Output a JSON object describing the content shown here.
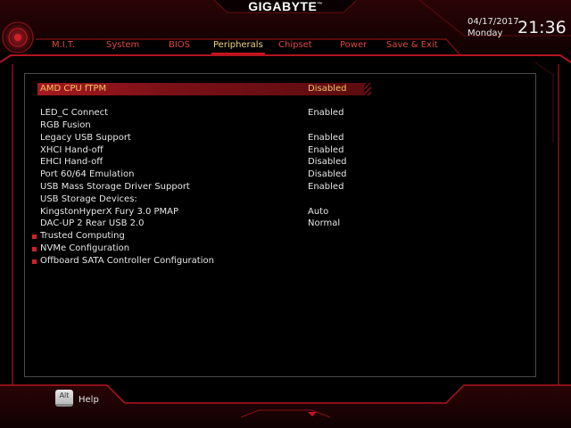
{
  "brand": "GIGABYTE",
  "brand_mark": "™",
  "clock": {
    "date": "04/17/2017",
    "day": "Monday",
    "time": "21:36"
  },
  "tabs": [
    {
      "label": "M.I.T."
    },
    {
      "label": "System"
    },
    {
      "label": "BIOS"
    },
    {
      "label": "Peripherals",
      "active": true
    },
    {
      "label": "Chipset"
    },
    {
      "label": "Power"
    },
    {
      "label": "Save & Exit"
    }
  ],
  "settings": [
    {
      "label": "AMD CPU fTPM",
      "value": "Disabled",
      "selected": true
    },
    {
      "label": "LED_C Connect",
      "value": "Enabled"
    },
    {
      "label": "RGB Fusion",
      "value": ""
    },
    {
      "label": "Legacy USB Support",
      "value": "Enabled"
    },
    {
      "label": "XHCI Hand-off",
      "value": "Enabled"
    },
    {
      "label": "EHCI Hand-off",
      "value": "Disabled"
    },
    {
      "label": "Port 60/64 Emulation",
      "value": "Disabled"
    },
    {
      "label": "USB Mass Storage Driver Support",
      "value": "Enabled"
    },
    {
      "label": "USB Storage Devices:",
      "value": ""
    },
    {
      "label": "KingstonHyperX Fury 3.0 PMAP",
      "value": "Auto"
    },
    {
      "label": "DAC-UP 2 Rear USB 2.0",
      "value": "Normal"
    },
    {
      "label": "Trusted Computing",
      "value": "",
      "submenu": true
    },
    {
      "label": "NVMe Configuration",
      "value": "",
      "submenu": true
    },
    {
      "label": "Offboard SATA Controller Configuration",
      "value": "",
      "submenu": true
    }
  ],
  "footer": {
    "key": "Alt",
    "help_label": "Help"
  },
  "colors": {
    "accent": "#c8141c",
    "active_tab": "#f1d480",
    "tab": "#e0483c",
    "selected_text": "#f1c35c"
  }
}
